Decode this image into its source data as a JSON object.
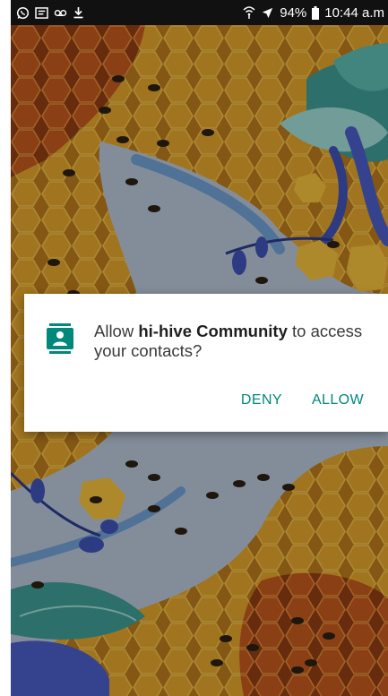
{
  "status_bar": {
    "left_icons": [
      "whatsapp-icon",
      "message-icon",
      "voicemail-icon",
      "download-icon"
    ],
    "right_icons": [
      "wifi-calling-icon",
      "airplane-mode-icon",
      "battery-icon"
    ],
    "battery": "94%",
    "time": "10:44 a.m"
  },
  "dialog": {
    "icon": "contacts-permission-icon",
    "message_before": "Allow ",
    "app_name": "hi-hive Community",
    "message_after": " to access your contacts?",
    "deny_label": "DENY",
    "allow_label": "ALLOW",
    "accent_color": "#00897b"
  },
  "wallpaper": {
    "description_colors": [
      "#e6a928",
      "#c4611c",
      "#b7c7d8",
      "#3b8f8d",
      "#4154b8"
    ]
  }
}
